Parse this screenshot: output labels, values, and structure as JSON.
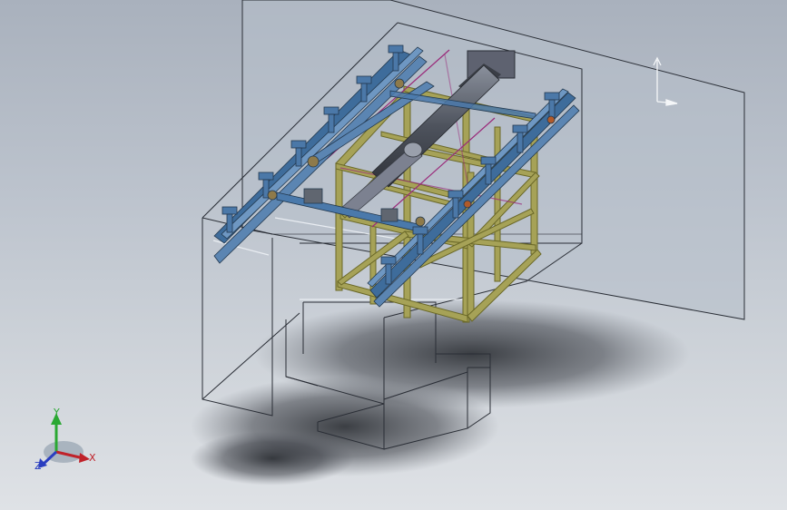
{
  "viewport": {
    "background_top": "#a9b1bd",
    "background_bottom": "#dfe2e6"
  },
  "colors": {
    "frame_yellow": "#8c8a3c",
    "frame_yellow_light": "#c7c37a",
    "rail_blue": "#3e6c9b",
    "rail_blue_light": "#6e97c2",
    "cylinder": "#585e6a",
    "magenta_line": "#9a2a7a",
    "wire_dark": "#2a2e36",
    "wire_light": "#eaf0f5"
  },
  "triad": {
    "x_label": "X",
    "y_label": "Y",
    "z_label": "Z",
    "x_color": "#c0222a",
    "y_color": "#2aa832",
    "z_color": "#2a3ec0"
  },
  "icons": [
    "view-orientation-triad-icon",
    "reference-triad-icon"
  ]
}
